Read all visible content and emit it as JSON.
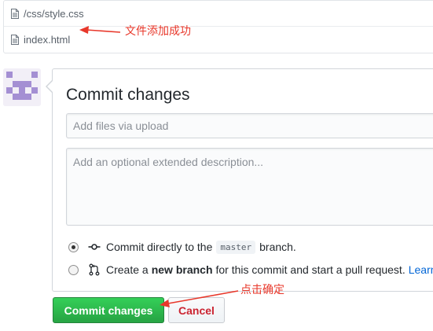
{
  "files": [
    {
      "name": "/css/style.css",
      "icon": "file-icon"
    },
    {
      "name": "index.html",
      "icon": "file-icon"
    }
  ],
  "annotations": {
    "file_added": "文件添加成功",
    "click_confirm": "点击确定",
    "color": "#e8372a"
  },
  "commit": {
    "title": "Commit changes",
    "summary_placeholder": "Add files via upload",
    "description_placeholder": "Add an optional extended description...",
    "options": {
      "direct": {
        "text_before": "Commit directly to the",
        "branch": "master",
        "text_after": "branch.",
        "icon": "git-commit-icon",
        "selected": true
      },
      "new_branch": {
        "text_before": "Create a",
        "strong": "new branch",
        "text_after": "for this commit and start a pull request.",
        "link": "Learn",
        "icon": "git-pull-request-icon",
        "selected": false
      }
    },
    "submit_label": "Commit changes",
    "cancel_label": "Cancel"
  },
  "colors": {
    "primary_button": "#28a745",
    "cancel_text": "#cb2431",
    "link": "#0366d6",
    "avatar": "#a48fd3"
  }
}
